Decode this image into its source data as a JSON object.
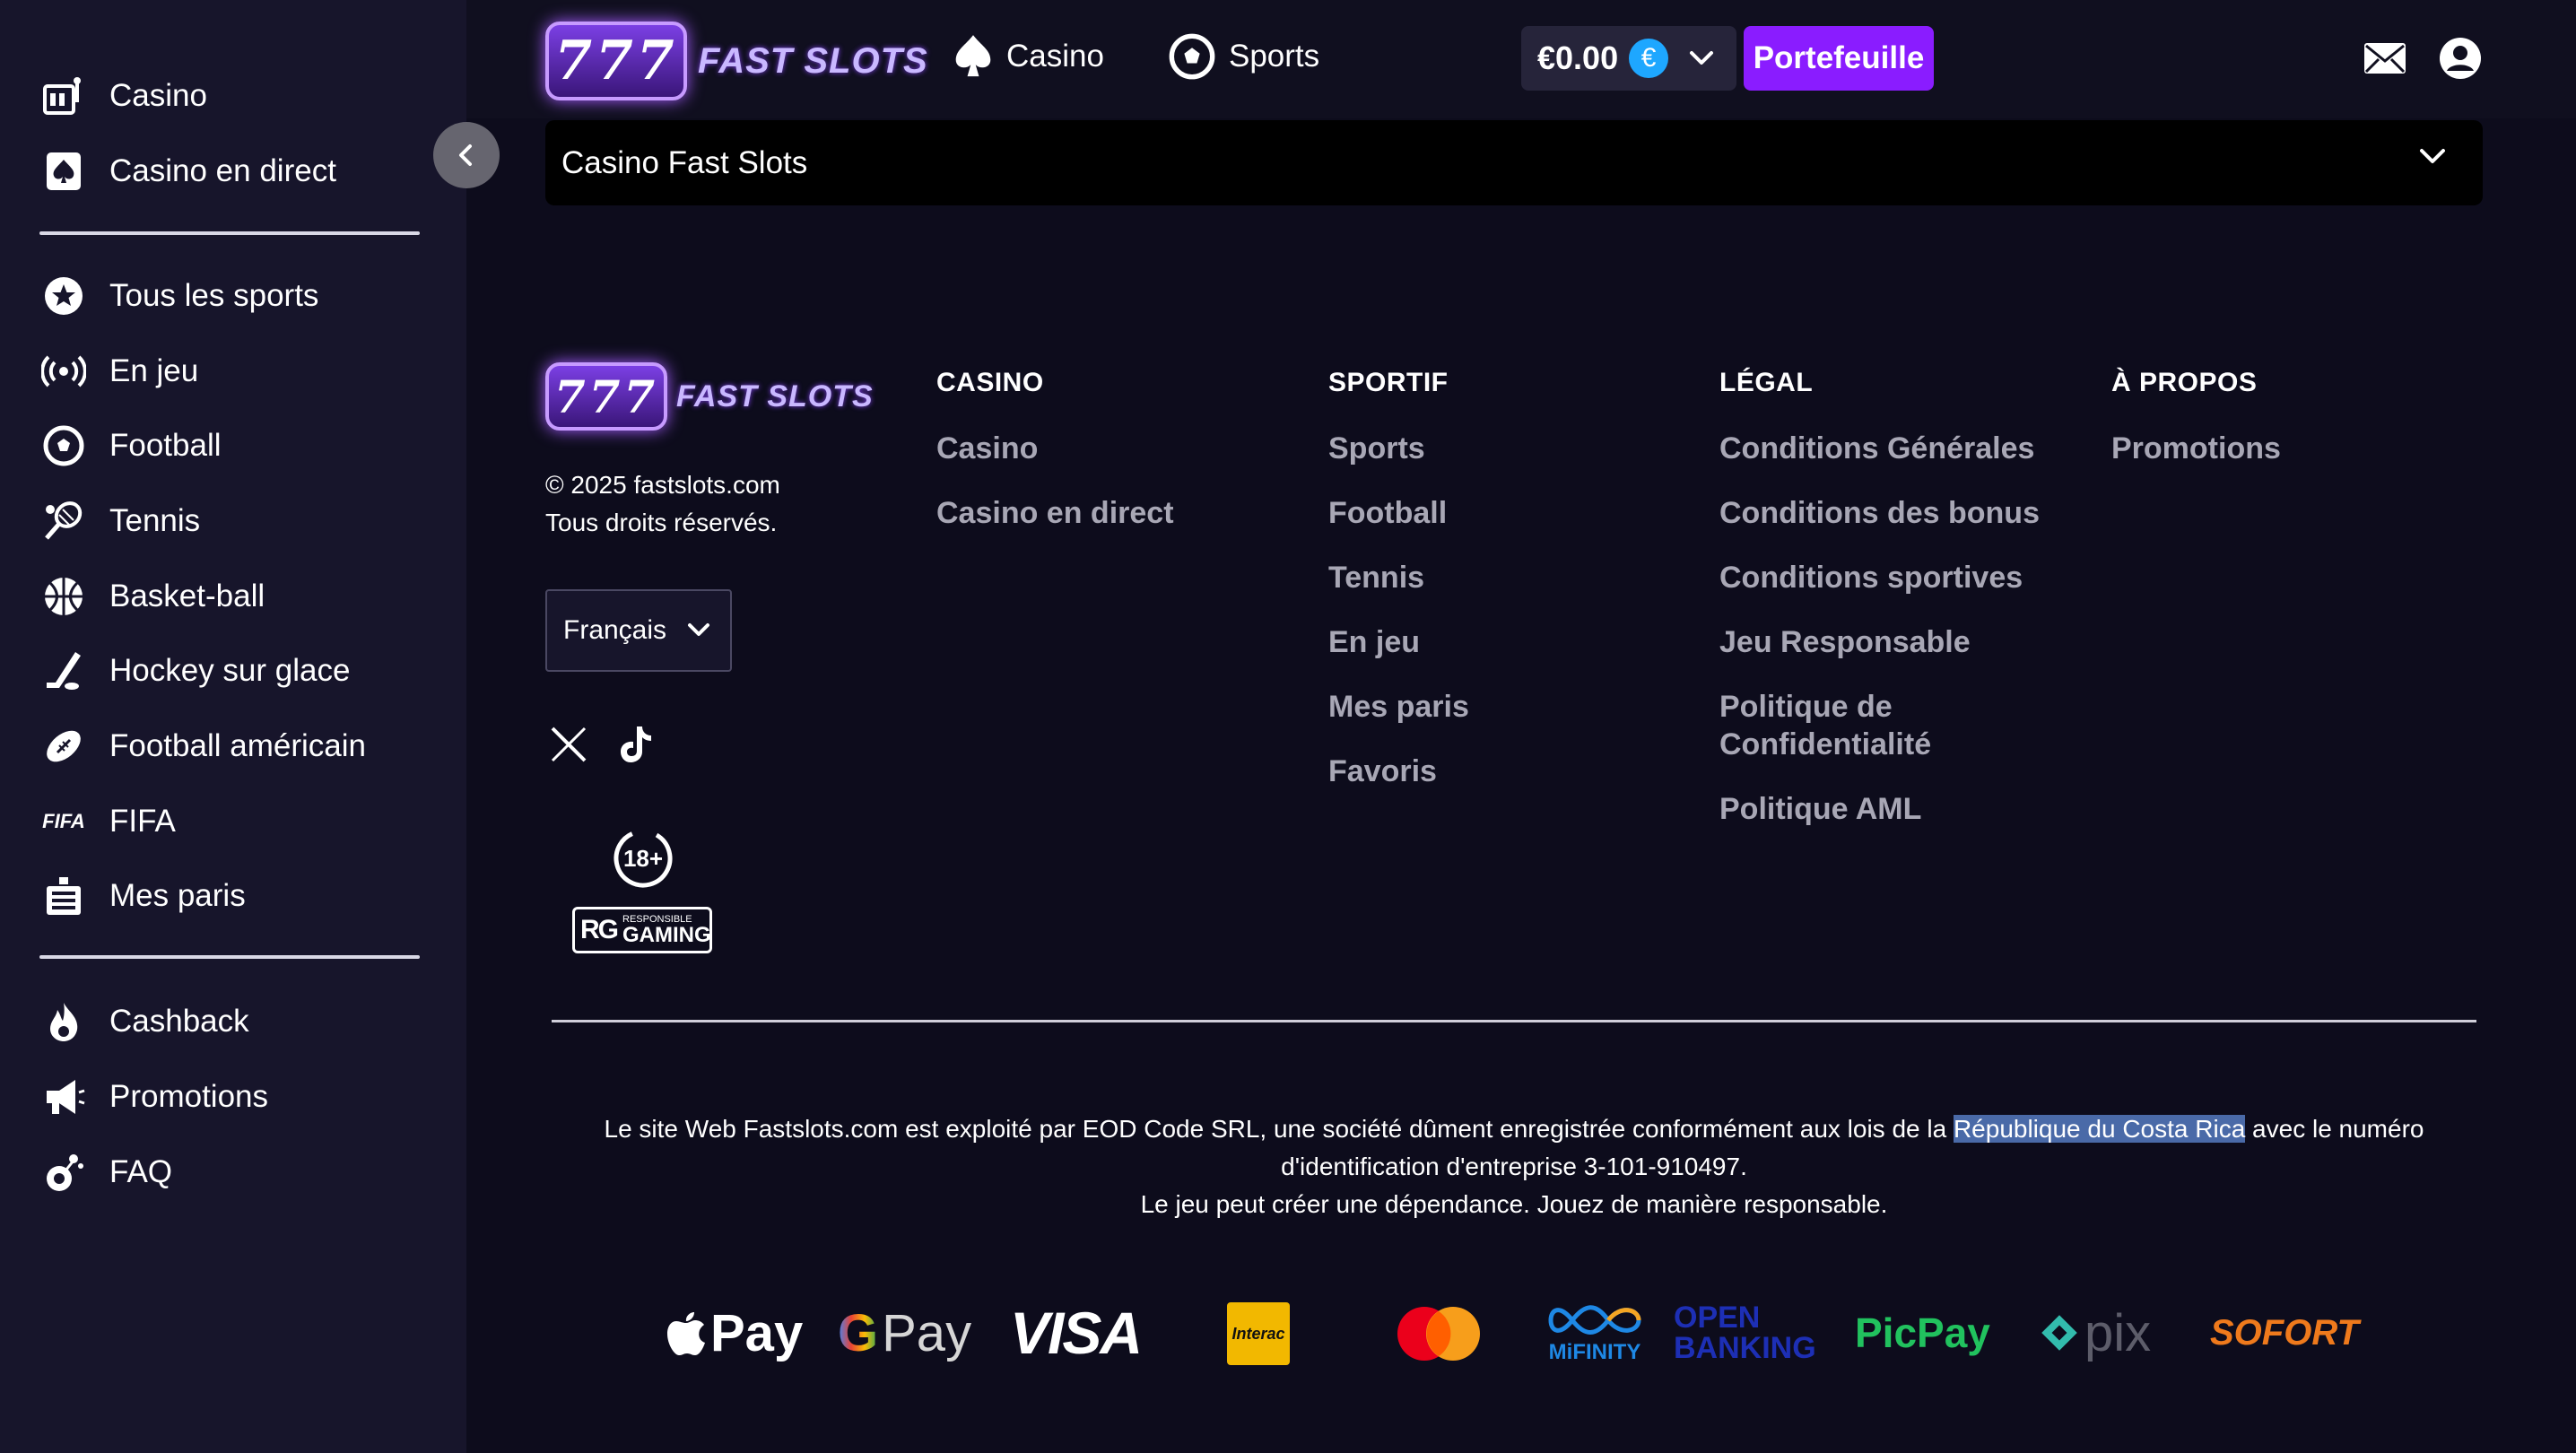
{
  "sidebar": {
    "group1": [
      {
        "label": "Casino",
        "icon": "slot-machine-icon"
      },
      {
        "label": "Casino en direct",
        "icon": "spade-card-icon"
      }
    ],
    "group2": [
      {
        "label": "Tous les sports",
        "icon": "star-badge-icon"
      },
      {
        "label": "En jeu",
        "icon": "live-broadcast-icon"
      },
      {
        "label": "Football",
        "icon": "soccer-ball-icon"
      },
      {
        "label": "Tennis",
        "icon": "tennis-racket-icon"
      },
      {
        "label": "Basket-ball",
        "icon": "basketball-icon"
      },
      {
        "label": "Hockey sur glace",
        "icon": "hockey-stick-icon"
      },
      {
        "label": "Football américain",
        "icon": "american-football-icon"
      },
      {
        "label": "FIFA",
        "icon": "fifa-icon"
      },
      {
        "label": "Mes paris",
        "icon": "bet-slip-icon"
      }
    ],
    "group3": [
      {
        "label": "Cashback",
        "icon": "flame-icon"
      },
      {
        "label": "Promotions",
        "icon": "megaphone-icon"
      },
      {
        "label": "FAQ",
        "icon": "faq-icon"
      }
    ],
    "fifa_text": "FIFA"
  },
  "header": {
    "logo_number": "777",
    "logo_text": "FAST SLOTS",
    "nav": [
      {
        "label": "Casino",
        "icon": "spade-icon"
      },
      {
        "label": "Sports",
        "icon": "soccer-ball-icon"
      }
    ],
    "balance": "€0.00",
    "currency_symbol": "€",
    "wallet_label": "Portefeuille",
    "icons": [
      "mail-icon",
      "user-icon"
    ]
  },
  "accordion": {
    "title": "Casino Fast Slots"
  },
  "footer": {
    "copyright_line1": "© 2025 fastslots.com",
    "copyright_line2": "Tous droits réservés.",
    "language": "Français",
    "socials": [
      "x-icon",
      "tiktok-icon"
    ],
    "age_badge": "18+",
    "rg_badge_small": "RESPONSIBLE",
    "rg_badge_big": "GAMING",
    "rg_badge_mark": "RG",
    "columns": [
      {
        "heading": "CASINO",
        "links": [
          "Casino",
          "Casino en direct"
        ]
      },
      {
        "heading": "SPORTIF",
        "links": [
          "Sports",
          "Football",
          "Tennis",
          "En jeu",
          "Mes paris",
          "Favoris"
        ]
      },
      {
        "heading": "LÉGAL",
        "links": [
          "Conditions Générales",
          "Conditions des bonus",
          "Conditions sportives",
          "Jeu Responsable",
          "Politique de Confidentialité",
          "Politique AML"
        ]
      },
      {
        "heading": "À PROPOS",
        "links": [
          "Promotions"
        ]
      }
    ],
    "legal_part1": "Le site Web Fastslots.com est exploité par EOD Code SRL, une société dûment enregistrée conformément aux lois de la ",
    "legal_highlight": "République du Costa Rica",
    "legal_part2": " avec le numéro d'identification d'entreprise 3-101-910497.",
    "legal_line3": "Le jeu peut créer une dépendance. Jouez de manière responsable.",
    "payments": {
      "apple_pay": "Pay",
      "google_pay_g": "G",
      "google_pay": "Pay",
      "visa": "VISA",
      "interac": "Interac",
      "mifinity": "MiFINITY",
      "open_banking_1": "OPEN",
      "open_banking_2": "BANKING",
      "picpay": "PicPay",
      "pix": "pix",
      "sofort": "SOFORT"
    }
  },
  "colors": {
    "background": "#0d0c1c",
    "sidebar": "#17152b",
    "accent_purple": "#8a1cff",
    "link_gray": "#a8a7b5",
    "highlight": "#4a6aa8"
  }
}
